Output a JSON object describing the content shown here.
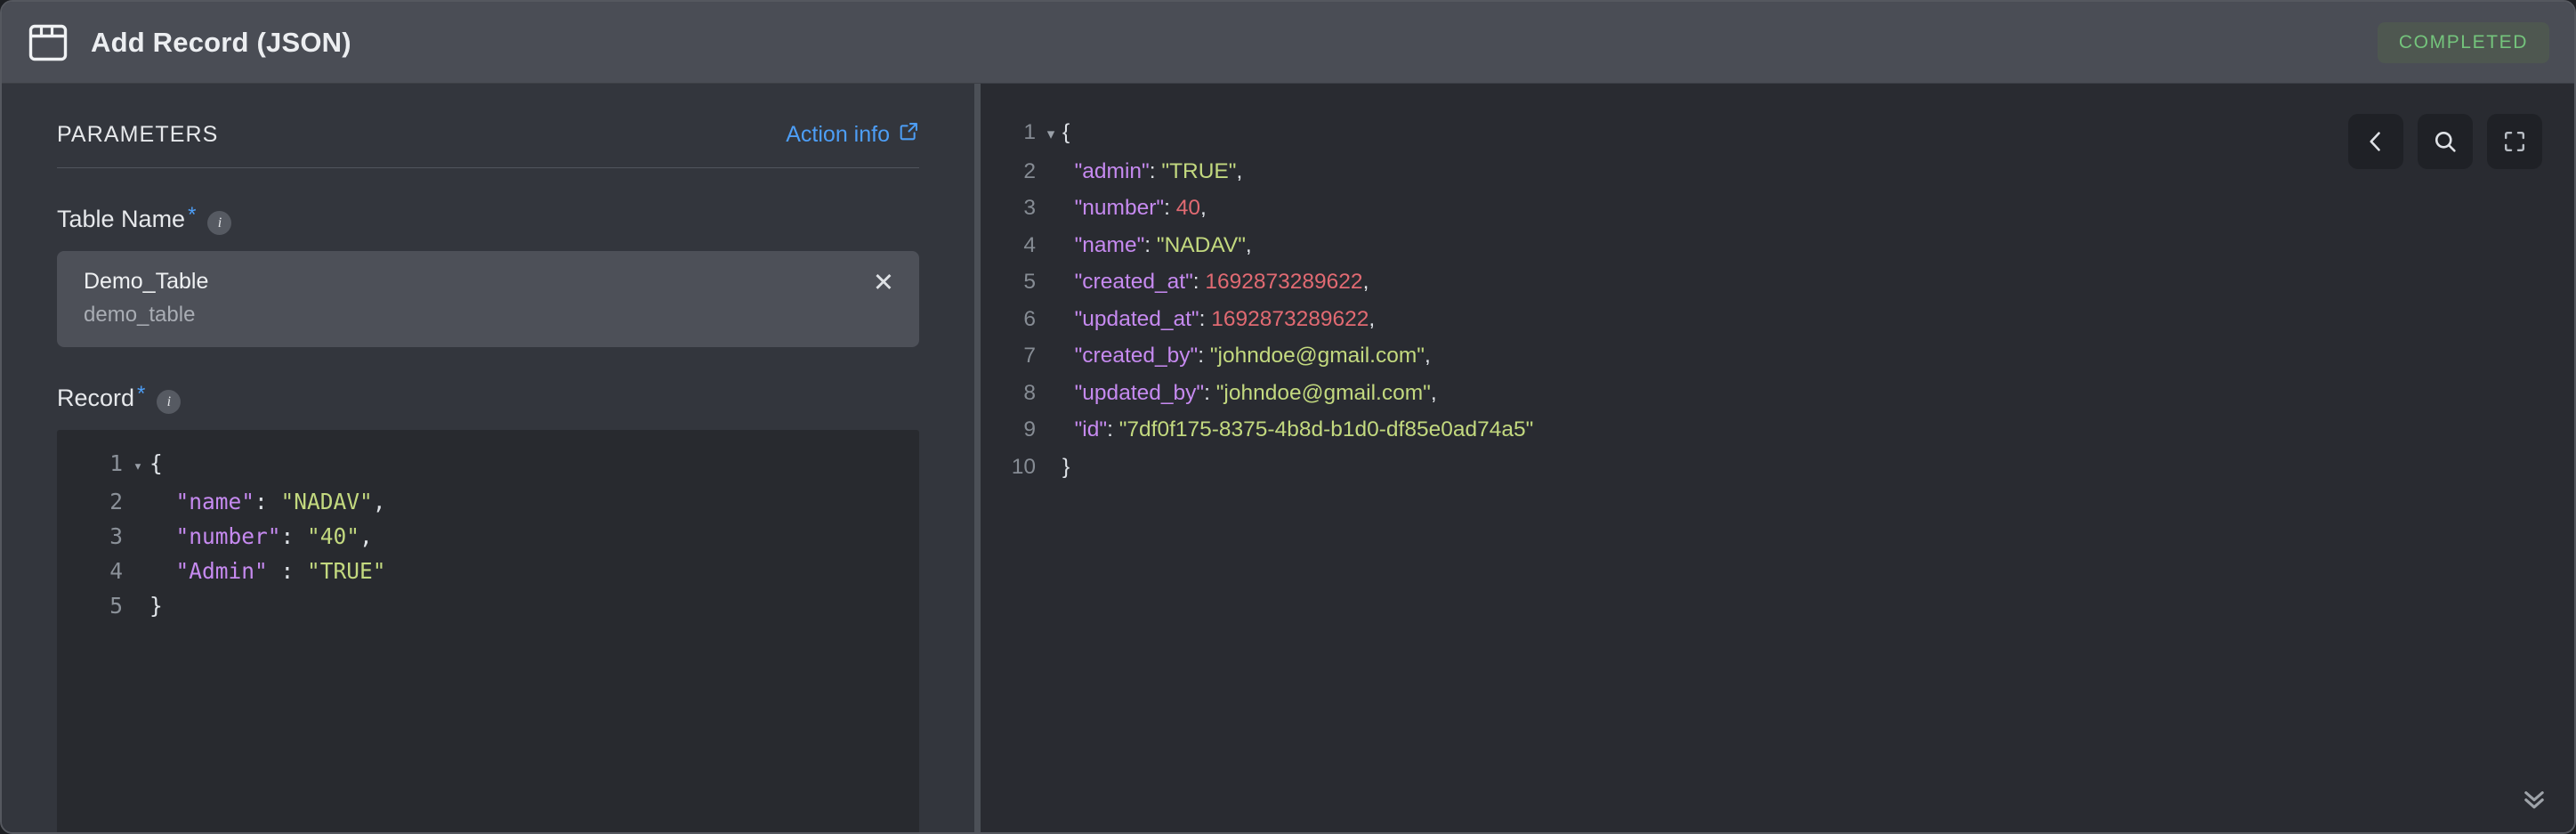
{
  "window": {
    "icon": "table-window-icon",
    "title": "Add Record (JSON)",
    "status_badge": "COMPLETED"
  },
  "colors": {
    "accent_blue": "#4d9ef6",
    "status_green": "#74c47c",
    "titlebar_bg": "#4a4d55",
    "panel_bg": "#33363d",
    "editor_bg": "#282a2f",
    "right_panel_bg": "#292b31",
    "json_key": "#c68af0",
    "json_string": "#c3d97f",
    "json_number": "#e16a72"
  },
  "left_panel": {
    "section_title": "PARAMETERS",
    "action_info_label": "Action info",
    "action_info_icon": "external-link-icon",
    "fields": [
      {
        "label": "Table Name",
        "required_marker": "*",
        "info_icon": "info-icon",
        "selected_primary": "Demo_Table",
        "selected_secondary": "demo_table",
        "clear_label": "✕"
      },
      {
        "label": "Record",
        "required_marker": "*",
        "info_icon": "info-icon"
      }
    ],
    "record_editor": {
      "lines": [
        {
          "n": "1",
          "fold": "▾",
          "tokens": [
            {
              "t": "{",
              "c": "punc"
            }
          ]
        },
        {
          "n": "2",
          "fold": "",
          "tokens": [
            {
              "t": "  \"name\"",
              "c": "key"
            },
            {
              "t": ": ",
              "c": "punc"
            },
            {
              "t": "\"NADAV\"",
              "c": "str"
            },
            {
              "t": ",",
              "c": "punc"
            }
          ]
        },
        {
          "n": "3",
          "fold": "",
          "tokens": [
            {
              "t": "  \"number\"",
              "c": "key"
            },
            {
              "t": ": ",
              "c": "punc"
            },
            {
              "t": "\"40\"",
              "c": "str"
            },
            {
              "t": ",",
              "c": "punc"
            }
          ]
        },
        {
          "n": "4",
          "fold": "",
          "tokens": [
            {
              "t": "  \"Admin\"",
              "c": "key"
            },
            {
              "t": " : ",
              "c": "punc"
            },
            {
              "t": "\"TRUE\"",
              "c": "str"
            }
          ]
        },
        {
          "n": "5",
          "fold": "",
          "tokens": [
            {
              "t": "}",
              "c": "punc"
            }
          ]
        }
      ]
    }
  },
  "right_panel": {
    "tools": [
      {
        "name": "back-chevron-icon",
        "label": "back"
      },
      {
        "name": "search-icon",
        "label": "search"
      },
      {
        "name": "fullscreen-icon",
        "label": "fullscreen"
      }
    ],
    "collapse_icon": "double-chevron-down-icon",
    "output_editor": {
      "lines": [
        {
          "n": "1",
          "fold": "▾",
          "tokens": [
            {
              "t": "{",
              "c": "punc"
            }
          ]
        },
        {
          "n": "2",
          "fold": "",
          "tokens": [
            {
              "t": "  \"admin\"",
              "c": "key"
            },
            {
              "t": ": ",
              "c": "punc"
            },
            {
              "t": "\"TRUE\"",
              "c": "str"
            },
            {
              "t": ",",
              "c": "punc"
            }
          ]
        },
        {
          "n": "3",
          "fold": "",
          "tokens": [
            {
              "t": "  \"number\"",
              "c": "key"
            },
            {
              "t": ": ",
              "c": "punc"
            },
            {
              "t": "40",
              "c": "num"
            },
            {
              "t": ",",
              "c": "punc"
            }
          ]
        },
        {
          "n": "4",
          "fold": "",
          "tokens": [
            {
              "t": "  \"name\"",
              "c": "key"
            },
            {
              "t": ": ",
              "c": "punc"
            },
            {
              "t": "\"NADAV\"",
              "c": "str"
            },
            {
              "t": ",",
              "c": "punc"
            }
          ]
        },
        {
          "n": "5",
          "fold": "",
          "tokens": [
            {
              "t": "  \"created_at\"",
              "c": "key"
            },
            {
              "t": ": ",
              "c": "punc"
            },
            {
              "t": "1692873289622",
              "c": "num"
            },
            {
              "t": ",",
              "c": "punc"
            }
          ]
        },
        {
          "n": "6",
          "fold": "",
          "tokens": [
            {
              "t": "  \"updated_at\"",
              "c": "key"
            },
            {
              "t": ": ",
              "c": "punc"
            },
            {
              "t": "1692873289622",
              "c": "num"
            },
            {
              "t": ",",
              "c": "punc"
            }
          ]
        },
        {
          "n": "7",
          "fold": "",
          "tokens": [
            {
              "t": "  \"created_by\"",
              "c": "key"
            },
            {
              "t": ": ",
              "c": "punc"
            },
            {
              "t": "\"johndoe@gmail.com\"",
              "c": "str"
            },
            {
              "t": ",",
              "c": "punc"
            }
          ]
        },
        {
          "n": "8",
          "fold": "",
          "tokens": [
            {
              "t": "  \"updated_by\"",
              "c": "key"
            },
            {
              "t": ": ",
              "c": "punc"
            },
            {
              "t": "\"johndoe@gmail.com\"",
              "c": "str"
            },
            {
              "t": ",",
              "c": "punc"
            }
          ]
        },
        {
          "n": "9",
          "fold": "",
          "tokens": [
            {
              "t": "  \"id\"",
              "c": "key"
            },
            {
              "t": ": ",
              "c": "punc"
            },
            {
              "t": "\"7df0f175-8375-4b8d-b1d0-df85e0ad74a5\"",
              "c": "str"
            }
          ]
        },
        {
          "n": "10",
          "fold": "",
          "tokens": [
            {
              "t": "}",
              "c": "punc"
            }
          ]
        }
      ]
    }
  }
}
